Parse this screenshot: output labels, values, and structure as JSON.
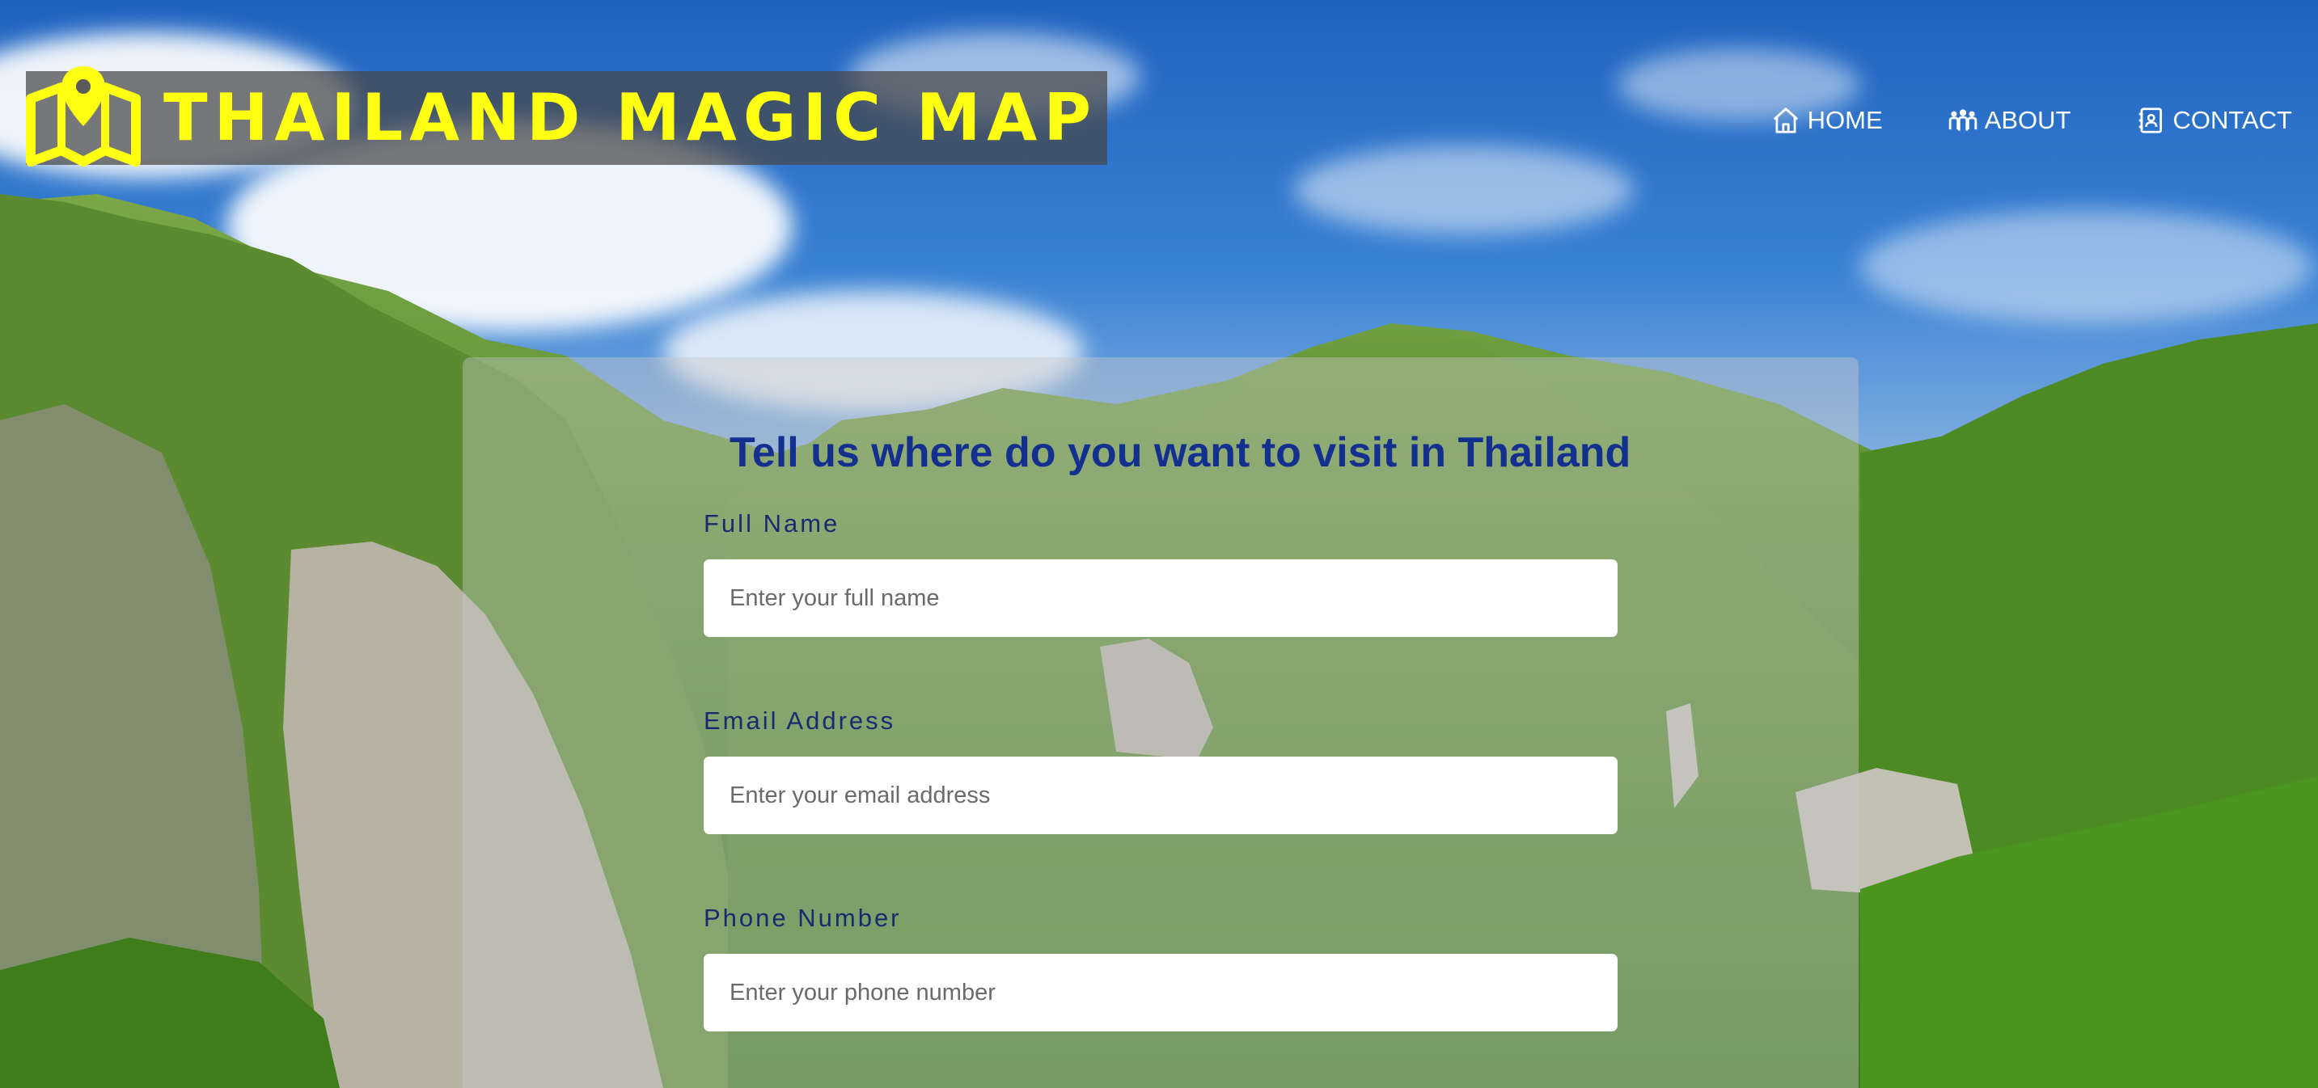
{
  "header": {
    "logo_text": "THAILAND MAGIC MAP",
    "logo_icon": "map-pin-icon",
    "nav": [
      {
        "label": "HOME",
        "icon": "home-icon"
      },
      {
        "label": "ABOUT",
        "icon": "people-icon"
      },
      {
        "label": "CONTACT",
        "icon": "contact-card-icon"
      }
    ]
  },
  "form": {
    "title": "Tell us where do you want to visit in Thailand",
    "fields": [
      {
        "label": "Full Name",
        "placeholder": "Enter your full name",
        "value": ""
      },
      {
        "label": "Email Address",
        "placeholder": "Enter your email address",
        "value": ""
      },
      {
        "label": "Phone Number",
        "placeholder": "Enter your phone number",
        "value": ""
      }
    ]
  },
  "colors": {
    "logo_text": "#ffff12",
    "title": "#13308e",
    "label": "#1a2a6e",
    "nav_text": "#ffffff"
  }
}
